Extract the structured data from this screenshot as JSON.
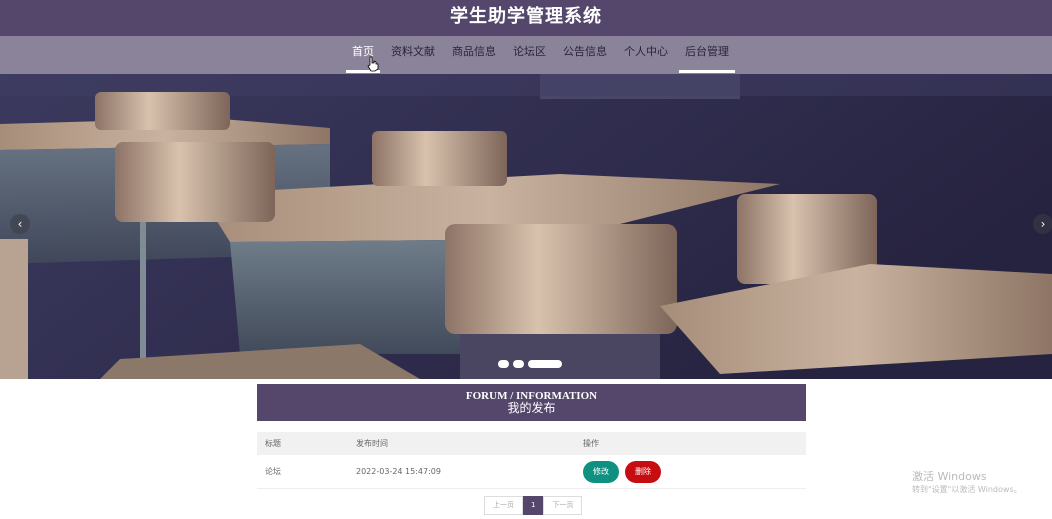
{
  "header": {
    "title": "学生助学管理系统"
  },
  "nav": {
    "items": [
      "首页",
      "资料文献",
      "商品信息",
      "论坛区",
      "公告信息",
      "个人中心",
      "后台管理"
    ]
  },
  "carousel": {
    "prev_icon": "chevron-left-icon",
    "next_icon": "chevron-right-icon",
    "dot_count": 3,
    "active_dot": 2
  },
  "panel": {
    "title_en": "FORUM / INFORMATION",
    "title_zh": "我的发布"
  },
  "table": {
    "columns": [
      "标题",
      "发布时间",
      "操作"
    ],
    "rows": [
      {
        "title": "论坛",
        "time": "2022-03-24 15:47:09",
        "edit_label": "修改",
        "delete_label": "删除"
      }
    ]
  },
  "pagination": {
    "prev": "上一页",
    "current": "1",
    "next": "下一页"
  },
  "watermark": {
    "line1": "激活 Windows",
    "line2": "转到\"设置\"以激活 Windows。"
  },
  "colors": {
    "primary": "#54476b",
    "nav_bg": "#8a839a",
    "edit": "#0f9181",
    "delete": "#c50d12"
  }
}
